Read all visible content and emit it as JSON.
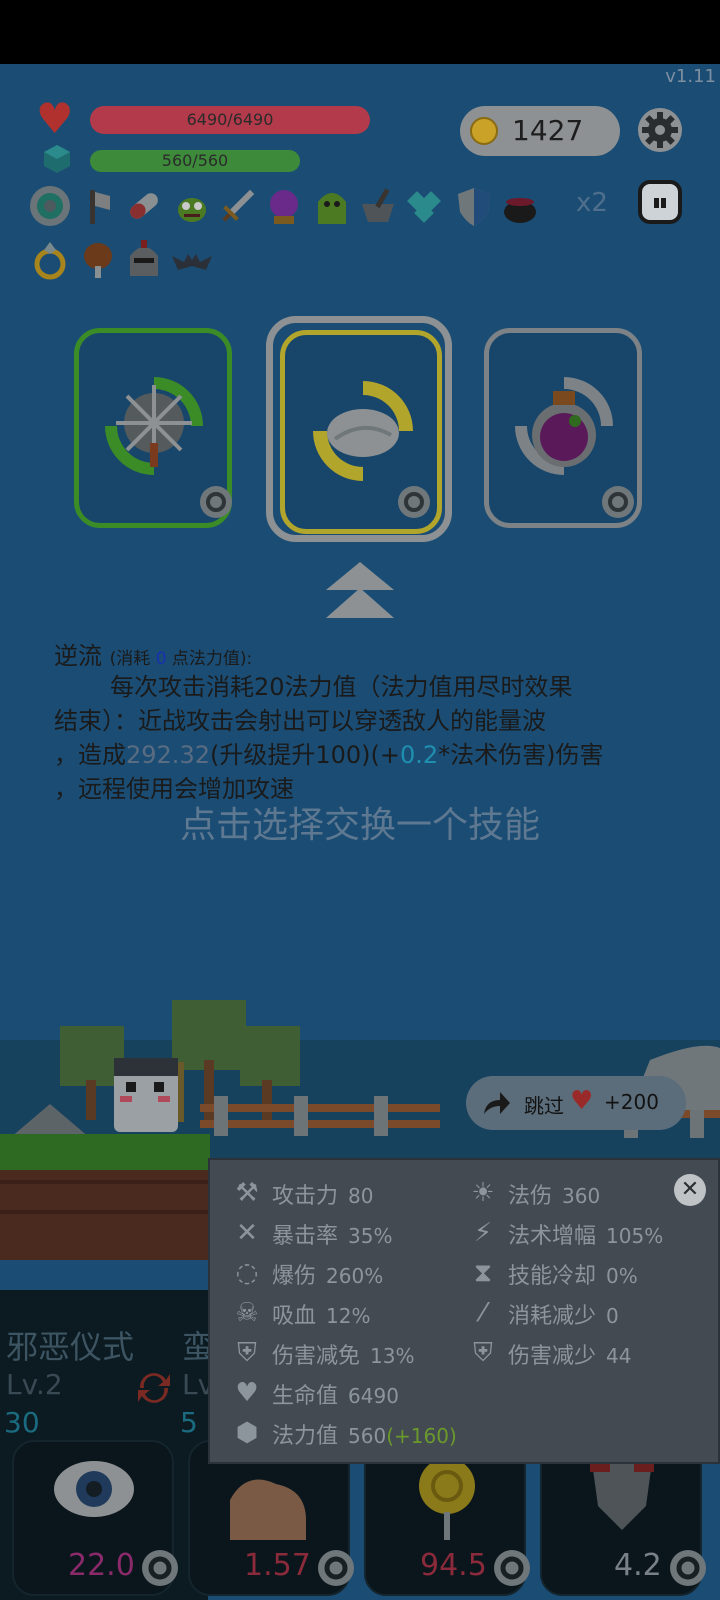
{
  "version": "v1.11",
  "player": {
    "hp": "6490/6490",
    "mp": "560/560"
  },
  "coins": "1427",
  "items_multiplier": "x2",
  "skill": {
    "name": "逆流",
    "cost_prefix": "(消耗",
    "cost_value": "0",
    "cost_suffix": "点法力值):",
    "desc_line1": "每次攻击消耗20法力值（法力值用尽时效果",
    "desc_line2": "结束）：近战攻击会射出可以穿透敌人的能量波",
    "desc_line3_a": "，造成",
    "desc_line3_b": "292.32",
    "desc_line3_c": "(升级提升100)(+",
    "desc_line3_d": "0.2",
    "desc_line3_e": "*法术伤害)伤害",
    "desc_line4": "，远程使用会增加攻速"
  },
  "prompt": "点击选择交换一个技能",
  "skip": {
    "label": "跳过",
    "reward": "+200"
  },
  "stats": {
    "attack": {
      "label": "攻击力",
      "value": "80"
    },
    "magic_damage": {
      "label": "法伤",
      "value": "360"
    },
    "crit_rate": {
      "label": "暴击率",
      "value": "35%"
    },
    "spell_amp": {
      "label": "法术增幅",
      "value": "105%"
    },
    "crit_damage": {
      "label": "爆伤",
      "value": "260%"
    },
    "cooldown": {
      "label": "技能冷却",
      "value": "0%"
    },
    "lifesteal": {
      "label": "吸血",
      "value": "12%"
    },
    "cost_reduction": {
      "label": "消耗减少",
      "value": "0"
    },
    "damage_reduction_pct": {
      "label": "伤害减免",
      "value": "13%"
    },
    "damage_reduction": {
      "label": "伤害减少",
      "value": "44"
    },
    "hp": {
      "label": "生命值",
      "value": "6490"
    },
    "mp": {
      "label": "法力值",
      "value": "560",
      "bonus": "(+160)"
    }
  },
  "relics": {
    "left_name": "邪恶仪式",
    "right_name_partial": "蛮",
    "left_lv": "Lv.2",
    "left_num": "30",
    "right_lv": "Lv",
    "right_num": "5"
  },
  "slots": [
    {
      "value": "22.0",
      "color": "#8a2a6a"
    },
    {
      "value": "1.57",
      "color": "#8a2a3a"
    },
    {
      "value": "94.5",
      "color": "#8a2a3a"
    },
    {
      "value": "4.2",
      "color": "#7a8288"
    }
  ],
  "colors": {
    "background": "#1b4d74",
    "hp_bar": "#b23a4a",
    "mp_bar": "#3c8a3a",
    "stats_panel": "#434a52"
  }
}
